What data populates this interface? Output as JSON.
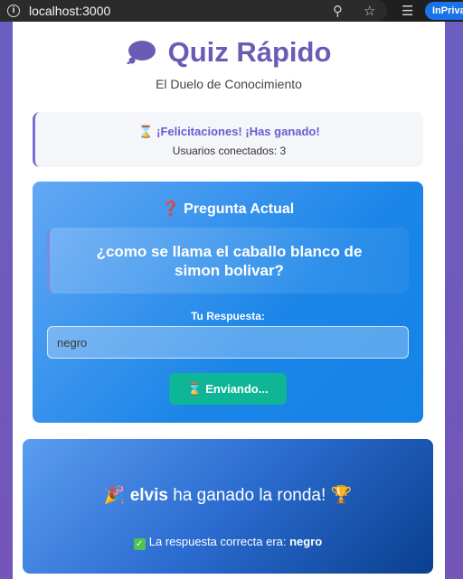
{
  "browser": {
    "url": "localhost:3000",
    "private_label": "InPrivate"
  },
  "app": {
    "title": "Quiz Rápido",
    "subtitle": "El Duelo de Conocimiento"
  },
  "status": {
    "message": "¡Felicitaciones! ¡Has ganado!",
    "users": "Usuarios conectados: 3"
  },
  "question": {
    "header": "Pregunta Actual",
    "text": "¿como se llama el caballo blanco de simon bolivar?",
    "answer_label": "Tu Respuesta:",
    "answer_value": "negro",
    "submit_label": "Enviando..."
  },
  "result": {
    "winner_name": "elvis",
    "winner_suffix": " ha ganado la ronda!",
    "correct_prefix": "La respuesta correcta era: ",
    "correct_answer": "negro"
  },
  "colors": {
    "accent": "#6b5bb5",
    "button": "#0fb597",
    "question_card": "#1c86e8",
    "winner_card": "#0a3f8e"
  }
}
